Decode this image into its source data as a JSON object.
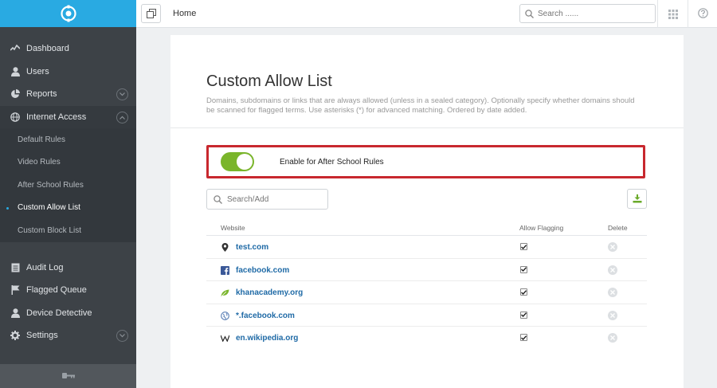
{
  "sidebar": {
    "items": [
      {
        "label": "Dashboard",
        "icon": "pulse-icon"
      },
      {
        "label": "Users",
        "icon": "user-icon"
      },
      {
        "label": "Reports",
        "icon": "pie-chart-icon"
      },
      {
        "label": "Internet Access",
        "icon": "globe-icon"
      }
    ],
    "subitems": [
      {
        "label": "Default Rules"
      },
      {
        "label": "Video Rules"
      },
      {
        "label": "After School Rules"
      },
      {
        "label": "Custom Allow List"
      },
      {
        "label": "Custom Block List"
      }
    ],
    "items2": [
      {
        "label": "Audit Log",
        "icon": "document-icon"
      },
      {
        "label": "Flagged Queue",
        "icon": "flag-icon"
      },
      {
        "label": "Device Detective",
        "icon": "user-icon"
      },
      {
        "label": "Settings",
        "icon": "gear-icon"
      }
    ],
    "active_subitem": "Custom Allow List"
  },
  "topbar": {
    "breadcrumb": "Home",
    "search_placeholder": "Search ......"
  },
  "page": {
    "title": "Custom Allow List",
    "description": "Domains, subdomains or links that are always allowed (unless in a sealed category). Optionally specify whether domains should be scanned for flagged terms. Use asterisks (*) for advanced matching. Ordered by date added.",
    "toggle_label": "Enable for After School Rules",
    "toggle_on": true,
    "add_placeholder": "Search/Add"
  },
  "table": {
    "headers": {
      "website": "Website",
      "allow_flagging": "Allow Flagging",
      "delete": "Delete"
    },
    "rows": [
      {
        "site": "test.com",
        "icon": "location-pin-icon",
        "flagging": true
      },
      {
        "site": "facebook.com",
        "icon": "facebook-icon",
        "flagging": true
      },
      {
        "site": "khanacademy.org",
        "icon": "leaf-icon",
        "flagging": true
      },
      {
        "site": "*.facebook.com",
        "icon": "globe-icon",
        "flagging": true
      },
      {
        "site": "en.wikipedia.org",
        "icon": "wikipedia-icon",
        "flagging": true
      }
    ]
  },
  "colors": {
    "accent": "#29aae2",
    "toggle_on": "#7ab52b",
    "highlight_border": "#c8282e",
    "link": "#1f6aa6"
  }
}
